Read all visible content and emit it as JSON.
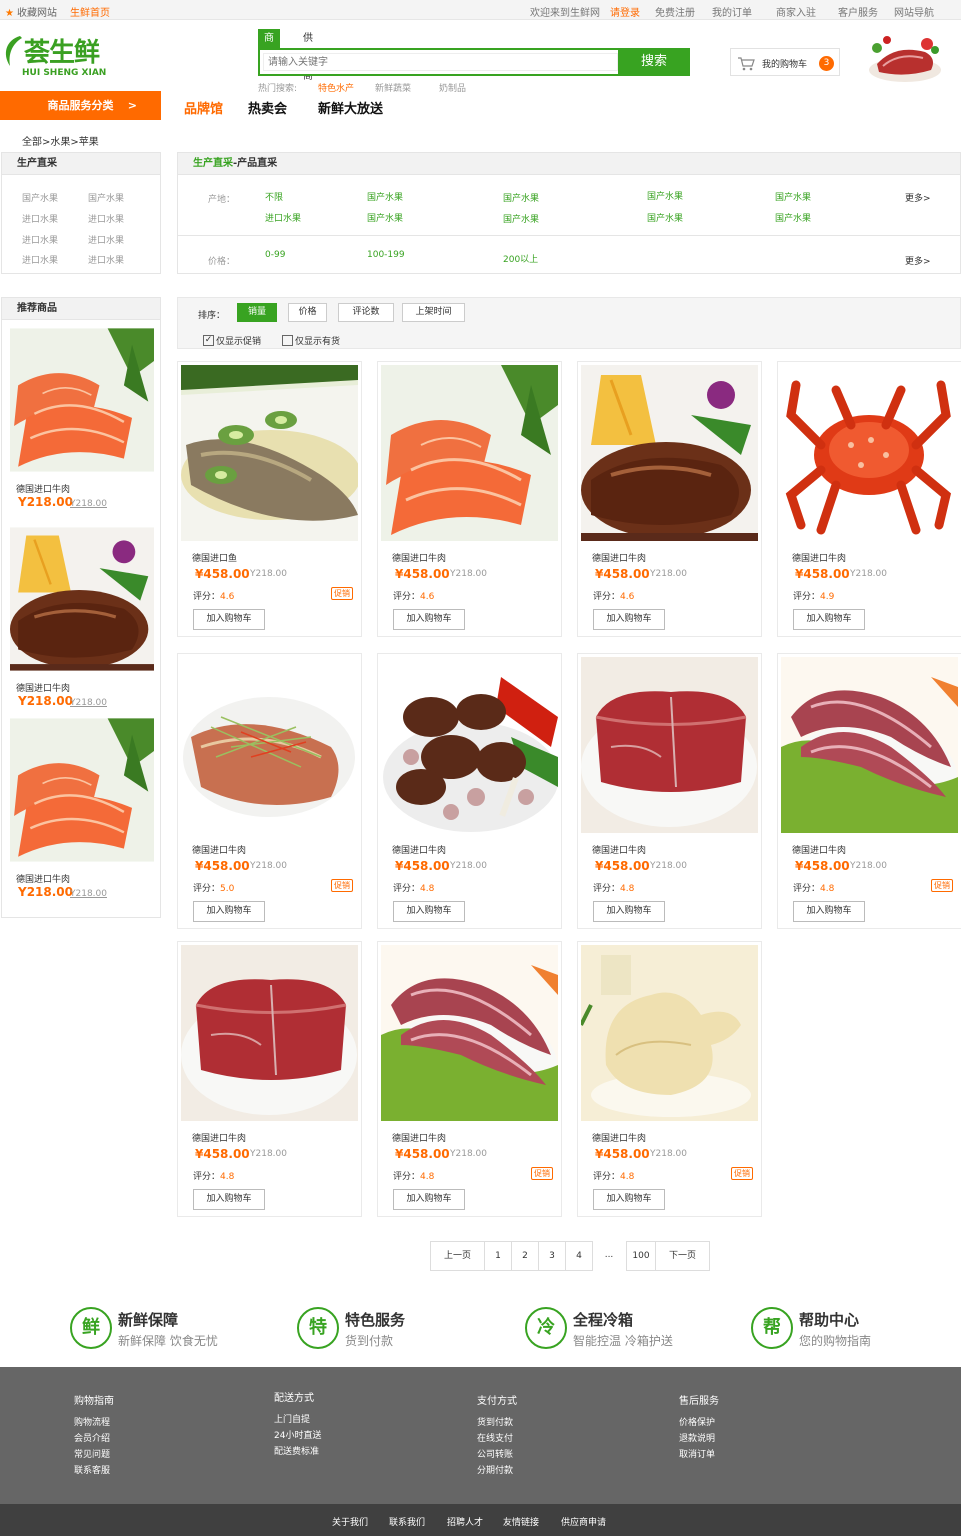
{
  "topbar": {
    "fav": "收藏网站",
    "home": "生鲜首页",
    "welcome": "欢迎来到生鲜网",
    "login": "请登录",
    "register": "免费注册",
    "orders": "我的订单",
    "merchant": "商家入驻",
    "service": "客户服务",
    "sitenav": "网站导航"
  },
  "brand": {
    "cn": "荟生鲜",
    "en": "HUI SHENG XIAN",
    "color": "#3aa022"
  },
  "search": {
    "tabs": [
      "商品",
      "供应商"
    ],
    "placeholder": "请输入关键字",
    "button": "搜索",
    "hot_label": "热门搜索:",
    "hot": [
      "特色水产",
      "新鲜蔬菜",
      "奶制品"
    ]
  },
  "cart": {
    "label": "我的购物车",
    "count": "3"
  },
  "nav": {
    "category_button": "商品服务分类",
    "arrow": ">",
    "items": [
      "品牌馆",
      "热卖会",
      "新鲜大放送"
    ]
  },
  "breadcrumb": "全部>水果>苹果",
  "produce_panel": {
    "title": "生产直采",
    "items": [
      "国产水果",
      "国产水果",
      "进口水果",
      "进口水果",
      "进口水果",
      "进口水果",
      "进口水果",
      "进口水果"
    ]
  },
  "filter_panel": {
    "title_green": "生产直采",
    "title_rest": "-产品直采",
    "origin_label": "产地：",
    "origin_row1": [
      "不限",
      "国产水果",
      "国产水果",
      "国产水果",
      "国产水果"
    ],
    "origin_row2": [
      "进口水果",
      "国产水果",
      "国产水果",
      "国产水果",
      "国产水果"
    ],
    "price_label": "价格：",
    "prices": [
      "0-99",
      "100-199",
      "200以上"
    ],
    "more": "更多>"
  },
  "recommend": {
    "title": "推荐商品",
    "items": [
      {
        "name": "德国进口牛肉",
        "price": "Y218.00",
        "old": "Y218.00",
        "img": "salmon"
      },
      {
        "name": "德国进口牛肉",
        "price": "Y218.00",
        "old": "Y218.00",
        "img": "steak"
      },
      {
        "name": "德国进口牛肉",
        "price": "Y218.00",
        "old": "Y218.00",
        "img": "salmon"
      }
    ]
  },
  "sort": {
    "label": "排序：",
    "buttons": [
      "销量",
      "价格",
      "评论数",
      "上架时间"
    ],
    "active": "销量",
    "checks": [
      "仅显示促销",
      "仅显示有货"
    ],
    "checked": [
      true,
      false
    ]
  },
  "product_labels": {
    "rate": "评分：",
    "add": "加入购物车",
    "promo": "促销"
  },
  "products": [
    {
      "name": "德国进口鱼",
      "price": "¥458.00",
      "old": "Y218.00",
      "rate": "4.6",
      "promo": true,
      "img": "fish"
    },
    {
      "name": "德国进口牛肉",
      "price": "¥458.00",
      "old": "Y218.00",
      "rate": "4.6",
      "promo": false,
      "img": "salmon"
    },
    {
      "name": "德国进口牛肉",
      "price": "¥458.00",
      "old": "Y218.00",
      "rate": "4.6",
      "promo": false,
      "img": "steak"
    },
    {
      "name": "德国进口牛肉",
      "price": "¥458.00",
      "old": "Y218.00",
      "rate": "4.9",
      "promo": false,
      "img": "crab"
    },
    {
      "name": "德国进口牛肉",
      "price": "¥458.00",
      "old": "Y218.00",
      "rate": "5.0",
      "promo": true,
      "img": "steamfish"
    },
    {
      "name": "德国进口牛肉",
      "price": "¥458.00",
      "old": "Y218.00",
      "rate": "4.8",
      "promo": false,
      "img": "bbq"
    },
    {
      "name": "德国进口牛肉",
      "price": "¥458.00",
      "old": "Y218.00",
      "rate": "4.8",
      "promo": false,
      "img": "beef"
    },
    {
      "name": "德国进口牛肉",
      "price": "¥458.00",
      "old": "Y218.00",
      "rate": "4.8",
      "promo": true,
      "img": "beefslice"
    },
    {
      "name": "德国进口牛肉",
      "price": "¥458.00",
      "old": "Y218.00",
      "rate": "4.8",
      "promo": false,
      "img": "beef"
    },
    {
      "name": "德国进口牛肉",
      "price": "¥458.00",
      "old": "Y218.00",
      "rate": "4.8",
      "promo": true,
      "img": "beefslice"
    },
    {
      "name": "德国进口牛肉",
      "price": "¥458.00",
      "old": "Y218.00",
      "rate": "4.8",
      "promo": true,
      "img": "duck"
    }
  ],
  "pager": {
    "prev": "上一页",
    "pages": [
      "1",
      "2",
      "3",
      "4"
    ],
    "ellipsis": "...",
    "last": "100",
    "next": "下一页"
  },
  "services": [
    {
      "icon": "鲜",
      "title": "新鲜保障",
      "sub": "新鲜保障  饮食无忧"
    },
    {
      "icon": "特",
      "title": "特色服务",
      "sub": "货到付款"
    },
    {
      "icon": "冷",
      "title": "全程冷箱",
      "sub": "智能控温  冷箱护送"
    },
    {
      "icon": "帮",
      "title": "帮助中心",
      "sub": "您的购物指南"
    }
  ],
  "footer": [
    {
      "title": "购物指南",
      "items": [
        "购物流程",
        "会员介绍",
        "常见问题",
        "联系客服"
      ]
    },
    {
      "title": "配送方式",
      "items": [
        "上门自提",
        "24小时直送",
        "配送费标准"
      ]
    },
    {
      "title": "支付方式",
      "items": [
        "货到付款",
        "在线支付",
        "公司转账",
        "分期付款"
      ]
    },
    {
      "title": "售后服务",
      "items": [
        "价格保护",
        "退款说明",
        "取消订单"
      ]
    }
  ],
  "bottom_links": [
    "关于我们",
    "联系我们",
    "招聘人才",
    "友情链接",
    "供应商申请"
  ],
  "colors": {
    "green": "#38a321",
    "orange": "#ff6a00"
  }
}
